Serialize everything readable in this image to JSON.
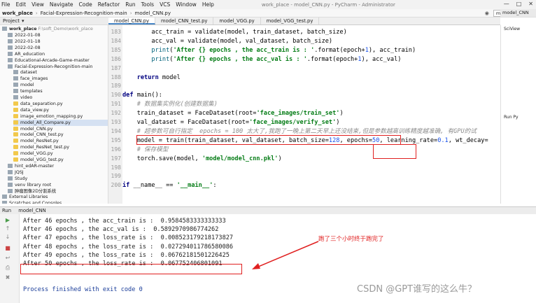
{
  "menubar": {
    "items": [
      "File",
      "Edit",
      "View",
      "Navigate",
      "Code",
      "Refactor",
      "Run",
      "Tools",
      "VCS",
      "Window",
      "Help"
    ],
    "title": "work_place - model_CNN.py - PyCharm - Administrator"
  },
  "navbar": {
    "crumbs": [
      "work_place",
      "Facial-Expression-Recognition-main",
      "model_CNN.py"
    ],
    "run_config": "model_CNN"
  },
  "project": {
    "header": "Project",
    "root": "work_place",
    "root_path": "F:\\soft_Demo\\work_place"
  },
  "tree": [
    {
      "label": "2022-01-08",
      "type": "folder",
      "indent": 1
    },
    {
      "label": "2022-01-18",
      "type": "folder",
      "indent": 1
    },
    {
      "label": "2022-02-08",
      "type": "folder",
      "indent": 1
    },
    {
      "label": "AR_education",
      "type": "folder",
      "indent": 1
    },
    {
      "label": "Educational-Arcade-Game-master",
      "type": "folder",
      "indent": 1
    },
    {
      "label": "Facial-Expression-Recognition-main",
      "type": "folder",
      "indent": 1
    },
    {
      "label": "dataset",
      "type": "folder",
      "indent": 2
    },
    {
      "label": "face_images",
      "type": "folder",
      "indent": 2
    },
    {
      "label": "model",
      "type": "folder",
      "indent": 2
    },
    {
      "label": "templates",
      "type": "folder",
      "indent": 2
    },
    {
      "label": "video",
      "type": "folder",
      "indent": 2
    },
    {
      "label": "data_separation.py",
      "type": "py",
      "indent": 2
    },
    {
      "label": "data_view.py",
      "type": "py",
      "indent": 2
    },
    {
      "label": "image_emotion_mapping.py",
      "type": "py",
      "indent": 2
    },
    {
      "label": "model_All_Compare.py",
      "type": "py",
      "indent": 2,
      "selected": true
    },
    {
      "label": "model_CNN.py",
      "type": "py",
      "indent": 2
    },
    {
      "label": "model_CNN_test.py",
      "type": "py",
      "indent": 2
    },
    {
      "label": "model_ResNet.py",
      "type": "py",
      "indent": 2
    },
    {
      "label": "model_ResNet_test.py",
      "type": "py",
      "indent": 2
    },
    {
      "label": "model_VGG.py",
      "type": "py",
      "indent": 2
    },
    {
      "label": "model_VGG_test.py",
      "type": "py",
      "indent": 2
    },
    {
      "label": "hint_edAR-master",
      "type": "folder",
      "indent": 1
    },
    {
      "label": "JQSJ",
      "type": "folder",
      "indent": 1
    },
    {
      "label": "Study",
      "type": "folder",
      "indent": 1
    },
    {
      "label": "venv  library root",
      "type": "folder",
      "indent": 1
    },
    {
      "label": "肿瘤图像2D分割系统",
      "type": "folder",
      "indent": 1
    },
    {
      "label": "External Libraries",
      "type": "folder",
      "indent": 0
    },
    {
      "label": "Scratches and Consoles",
      "type": "folder",
      "indent": 0
    }
  ],
  "tabs": [
    "model_CNN.py",
    "model_CNN_test.py",
    "model_VGG.py",
    "model_VGG_test.py"
  ],
  "right_panel": {
    "tab": "model_CNN",
    "items": [
      "SciView",
      "Run Py"
    ]
  },
  "gutter": [
    "183",
    "184",
    "185",
    "186",
    "187",
    "188",
    "189",
    "190",
    "191",
    "192",
    "193",
    "194",
    "195",
    "196",
    "197",
    "198",
    "199",
    "200"
  ],
  "code_lines": [
    "        acc_train = validate(model, train_dataset, batch_size)",
    "        acc_val = validate(model, val_dataset, batch_size)",
    "        print('After {} epochs , the acc_train is : '.format(epoch+1), acc_train)",
    "        print('After {} epochs , the acc_val is : '.format(epoch+1), acc_val)",
    "",
    "    return model",
    "",
    "def main():",
    "    # 数据集实例化(创建数据集)",
    "    train_dataset = FaceDataset(root='face_images/train_set')",
    "    val_dataset = FaceDataset(root='face_images/verify_set')",
    "    # 超参数可自行指定  epochs = 100 太大了,我跑了一晚上第二天早上还没结束,但是参数越高训练精度越准确, 有GPU的试",
    "    model = train(train_dataset, val_dataset, batch_size=128, epochs=50, learning_rate=0.1, wt_decay=",
    "    # 保存模型",
    "    torch.save(model, 'model/model_cnn.pkl')",
    "",
    "",
    "if __name__ == '__main__':"
  ],
  "run": {
    "label": "Run",
    "config": "model_CNN"
  },
  "console_lines": [
    "After 46 epochs , the acc_train is :  0.9584583333333333",
    "After 46 epochs , the acc_val is :  0.5892970986774262",
    "After 47 epochs , the loss_rate is :  0.008523179218173827",
    "After 48 epochs , the loss_rate is :  0.027294011786580086",
    "After 49 epochs , the loss_rate is :  0.06762181501226425",
    "After 50 epochs , the loss_rate is :  0.067752406801091",
    "",
    "Process finished with exit code 0"
  ],
  "annotation": "跑了三个小时终于跑完了",
  "watermark": "CSDN @GPT谁写的这么牛？",
  "colors": {
    "accent": "#e02020",
    "keyword": "#000080",
    "string": "#067d17"
  }
}
